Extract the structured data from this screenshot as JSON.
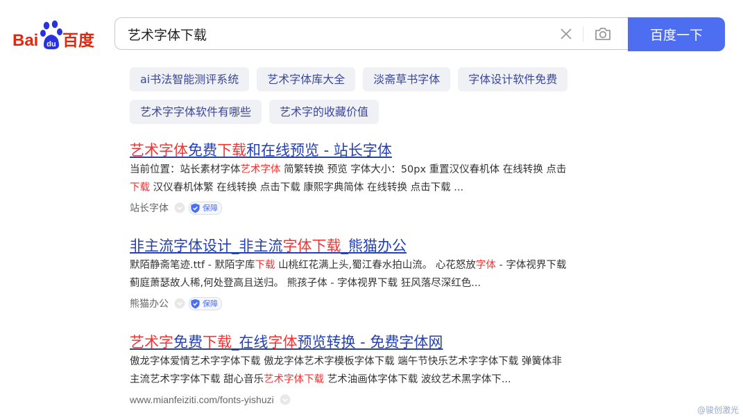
{
  "logo": {
    "left": "Bai",
    "paw": "du",
    "right": "百度"
  },
  "search": {
    "query": "艺术字体下载",
    "button_label": "百度一下"
  },
  "related_tags": [
    [
      "ai书法智能测评系统",
      "艺术字体库大全",
      "淡斋草书字体",
      "字体设计软件免费"
    ],
    [
      "艺术字字体软件有哪些",
      "艺术字的收藏价值"
    ]
  ],
  "results": [
    {
      "title": [
        {
          "t": "艺术字体",
          "hl": true
        },
        {
          "t": "免费",
          "hl": false
        },
        {
          "t": "下载",
          "hl": true
        },
        {
          "t": "和在线预览 - 站长字体",
          "hl": false
        }
      ],
      "abstract_lines": [
        [
          {
            "t": "当前位置：站长素材字体",
            "hl": false
          },
          {
            "t": "艺术字体",
            "hl": true
          },
          {
            "t": " 简繁转换 预览 字体大小：50px 重置汉仪春机体 在线转换 点击",
            "hl": false
          }
        ],
        [
          {
            "t": "下载",
            "hl": true
          },
          {
            "t": " 汉仪春机体繁 在线转换 点击下载 康熙字典简体 在线转换 点击下载 ...",
            "hl": false
          }
        ]
      ],
      "source": "站长字体",
      "badge": "保障"
    },
    {
      "title": [
        {
          "t": "非主流字体设计_非主流",
          "hl": false
        },
        {
          "t": "字体下载",
          "hl": true
        },
        {
          "t": "_熊猫办公",
          "hl": false
        }
      ],
      "abstract_lines": [
        [
          {
            "t": "默陌静斋笔迹.ttf - 默陌字库",
            "hl": false
          },
          {
            "t": "下载",
            "hl": true
          },
          {
            "t": " 山桃红花满上头,蜀江春水拍山流。 心花怒放",
            "hl": false
          },
          {
            "t": "字体",
            "hl": true
          },
          {
            "t": " - 字体视界下载",
            "hl": false
          }
        ],
        [
          {
            "t": "蓟庭萧瑟故人稀,何处登高且送归。 熊孩子体 - 字体视界下载 狂风落尽深红色...",
            "hl": false
          }
        ]
      ],
      "source": "熊猫办公",
      "badge": "保障"
    },
    {
      "title": [
        {
          "t": "艺术字",
          "hl": true
        },
        {
          "t": "免费",
          "hl": false
        },
        {
          "t": "下载",
          "hl": true
        },
        {
          "t": "_在线",
          "hl": false
        },
        {
          "t": "字体",
          "hl": true
        },
        {
          "t": "预览转换 - 免费字体网",
          "hl": false
        }
      ],
      "abstract_lines": [
        [
          {
            "t": "傲龙字体爱情艺术字字体下载 傲龙字体艺术字模板字体下载 端午节快乐艺术字字体下载 弹簧体非",
            "hl": false
          }
        ],
        [
          {
            "t": "主流艺术字字体下载 甜心音乐",
            "hl": false
          },
          {
            "t": "艺术字体下载",
            "hl": true
          },
          {
            "t": " 艺术油画体字体下载 波纹艺术黑字体下...",
            "hl": false
          }
        ]
      ],
      "source": "www.mianfeiziti.com/fonts-yishuzi",
      "badge": ""
    }
  ],
  "watermark": "@骏创激光",
  "colors": {
    "brand_blue": "#4e6ef2",
    "logo_red": "#de2910",
    "highlight": "#f73131",
    "link": "#2440b3"
  }
}
